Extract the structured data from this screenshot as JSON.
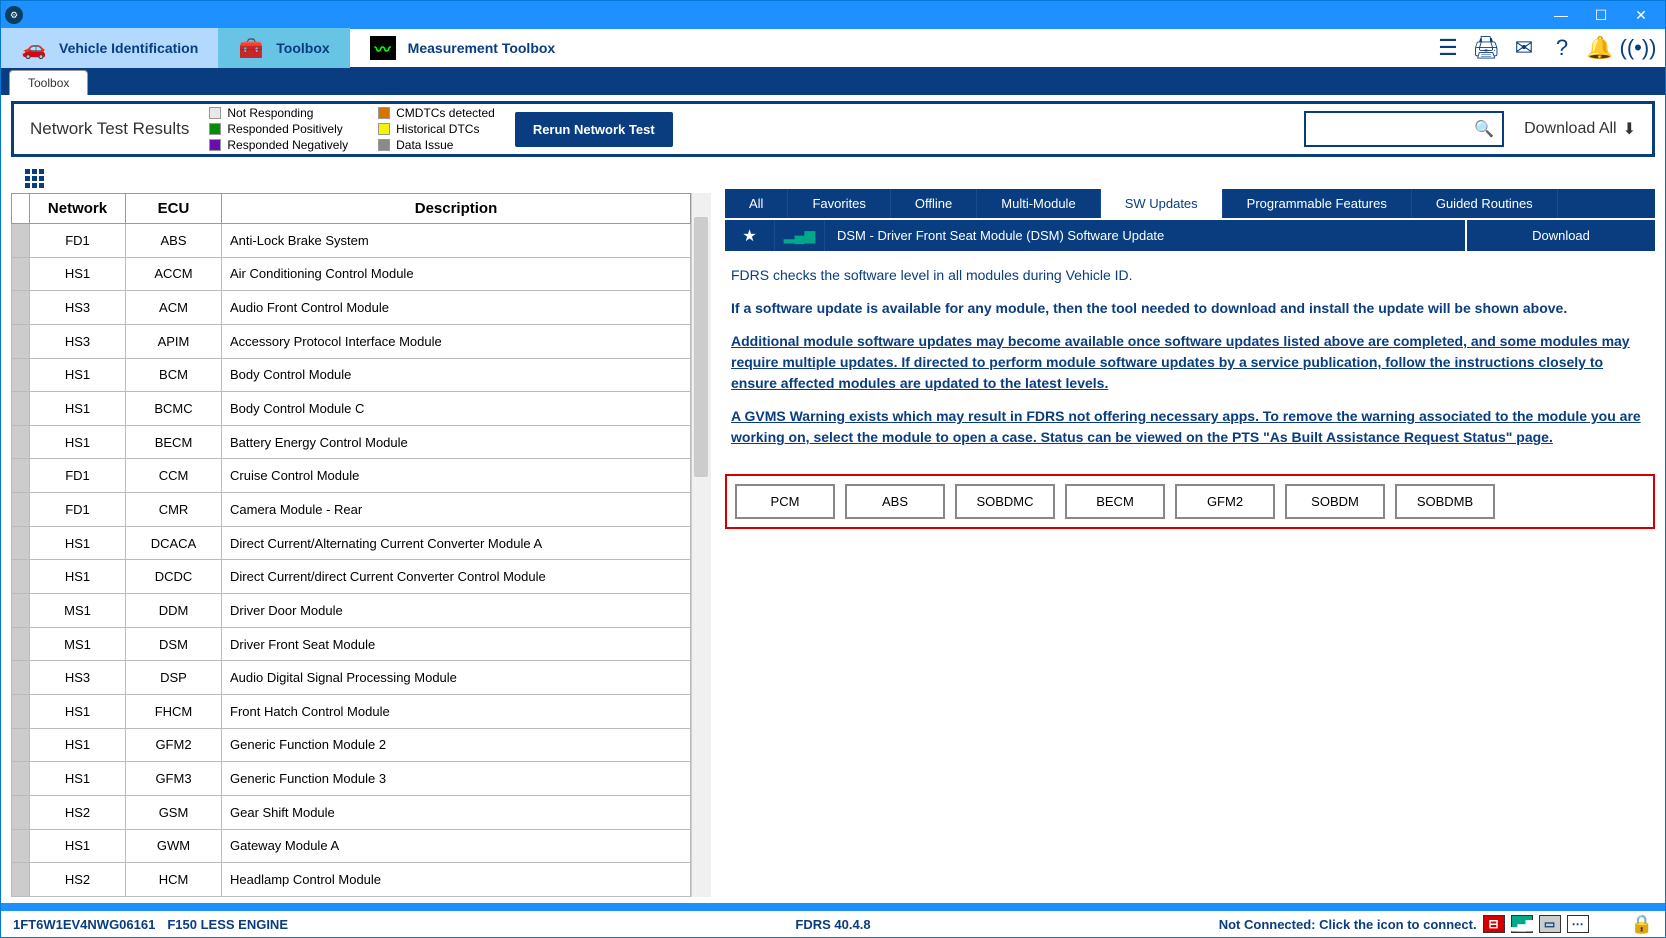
{
  "window": {
    "min": "—",
    "max": "☐",
    "close": "✕"
  },
  "nav": {
    "vehicle": "Vehicle Identification",
    "toolbox": "Toolbox",
    "measure": "Measurement Toolbox"
  },
  "subtab": "Toolbox",
  "test_bar": {
    "title": "Network Test Results",
    "legend": {
      "not_responding": "Not Responding",
      "responded_pos": "Responded Positively",
      "responded_neg": "Responded Negatively",
      "cmdtcs": "CMDTCs detected",
      "historical": "Historical DTCs",
      "data_issue": "Data Issue"
    },
    "rerun": "Rerun Network Test",
    "download_all": "Download All"
  },
  "columns": {
    "network": "Network",
    "ecu": "ECU",
    "description": "Description"
  },
  "rows": [
    {
      "net": "FD1",
      "ecu": "ABS",
      "desc": "Anti-Lock Brake System"
    },
    {
      "net": "HS1",
      "ecu": "ACCM",
      "desc": "Air Conditioning Control Module"
    },
    {
      "net": "HS3",
      "ecu": "ACM",
      "desc": "Audio Front Control Module"
    },
    {
      "net": "HS3",
      "ecu": "APIM",
      "desc": "Accessory Protocol Interface Module"
    },
    {
      "net": "HS1",
      "ecu": "BCM",
      "desc": "Body Control Module"
    },
    {
      "net": "HS1",
      "ecu": "BCMC",
      "desc": "Body Control Module C"
    },
    {
      "net": "HS1",
      "ecu": "BECM",
      "desc": "Battery Energy Control Module"
    },
    {
      "net": "FD1",
      "ecu": "CCM",
      "desc": "Cruise Control Module"
    },
    {
      "net": "FD1",
      "ecu": "CMR",
      "desc": "Camera Module - Rear"
    },
    {
      "net": "HS1",
      "ecu": "DCACA",
      "desc": "Direct Current/Alternating Current Converter Module A"
    },
    {
      "net": "HS1",
      "ecu": "DCDC",
      "desc": "Direct Current/direct Current Converter Control Module"
    },
    {
      "net": "MS1",
      "ecu": "DDM",
      "desc": "Driver Door Module"
    },
    {
      "net": "MS1",
      "ecu": "DSM",
      "desc": "Driver Front Seat Module"
    },
    {
      "net": "HS3",
      "ecu": "DSP",
      "desc": "Audio Digital Signal Processing Module"
    },
    {
      "net": "HS1",
      "ecu": "FHCM",
      "desc": "Front Hatch Control Module"
    },
    {
      "net": "HS1",
      "ecu": "GFM2",
      "desc": "Generic Function Module 2"
    },
    {
      "net": "HS1",
      "ecu": "GFM3",
      "desc": "Generic Function Module 3"
    },
    {
      "net": "HS2",
      "ecu": "GSM",
      "desc": "Gear Shift Module"
    },
    {
      "net": "HS1",
      "ecu": "GWM",
      "desc": "Gateway Module A"
    },
    {
      "net": "HS2",
      "ecu": "HCM",
      "desc": "Headlamp Control Module"
    }
  ],
  "tabs": {
    "all": "All",
    "favorites": "Favorites",
    "offline": "Offline",
    "multi": "Multi-Module",
    "sw": "SW Updates",
    "prog": "Programmable Features",
    "guided": "Guided Routines"
  },
  "update": {
    "title": "DSM - Driver Front Seat Module (DSM) Software Update",
    "download": "Download"
  },
  "info": {
    "p1": "FDRS checks the software level in all modules during Vehicle ID.",
    "p2": "If a software update is available for any module, then the tool needed to download and install the update will be shown above.",
    "p3": "Additional module software updates may become available once software updates listed above are completed, and some modules may require multiple updates. If directed to perform module software updates by a service publication, follow the instructions closely to ensure affected modules are updated to the latest levels.",
    "p4": "A GVMS Warning exists which may result in FDRS not offering necessary apps. To remove the warning associated to the module you are working on, select the module to open a case. Status can be viewed on the PTS \"As Built Assistance Request Status\" page."
  },
  "warning_buttons": [
    "PCM",
    "ABS",
    "SOBDMC",
    "BECM",
    "GFM2",
    "SOBDM",
    "SOBDMB"
  ],
  "status": {
    "vin": "1FT6W1EV4NWG06161",
    "vehicle": "F150 LESS ENGINE",
    "version": "FDRS 40.4.8",
    "connection": "Not Connected: Click the icon to connect."
  }
}
